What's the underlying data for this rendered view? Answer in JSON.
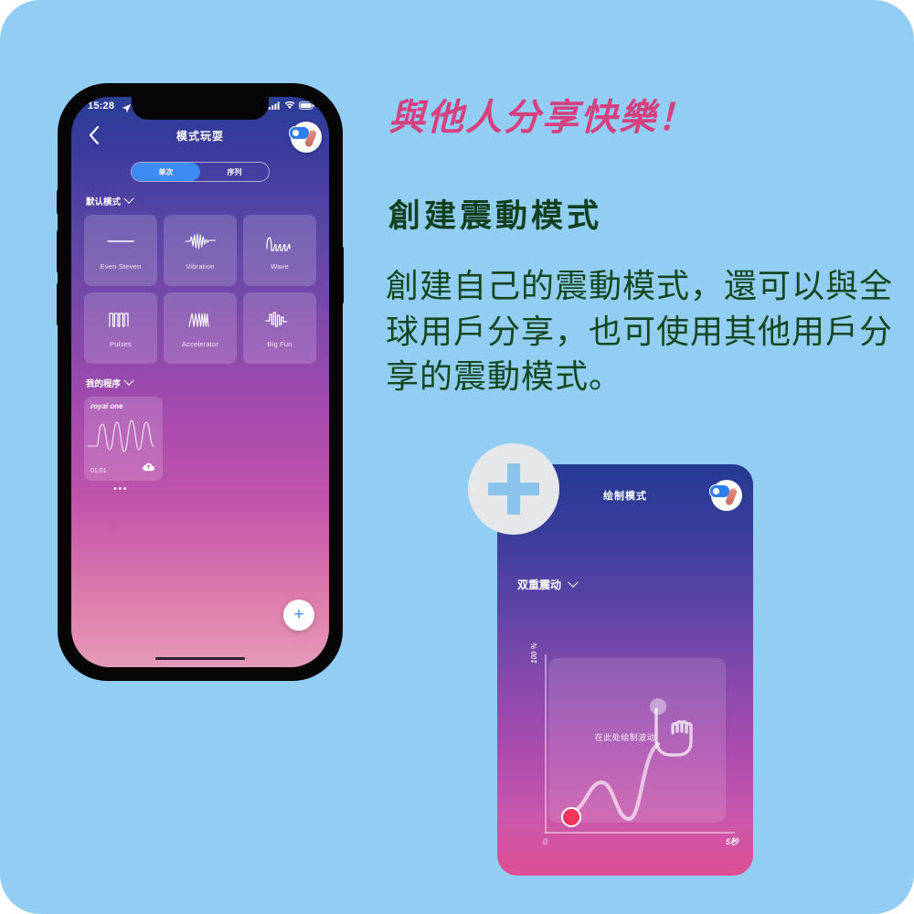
{
  "theme": {
    "background": "#92cdf4",
    "headline_color": "#d6407f",
    "text_color": "#14471f",
    "accent_blue": "#3d8bf5",
    "dot_red": "#f8335e"
  },
  "promo": {
    "headline": "與他人分享快樂！",
    "subheading": "創建震動模式",
    "body": "創建自己的震動模式，還可以與全球用戶分享，也可使用其他用戶分享的震動模式。"
  },
  "phone": {
    "statusbar": {
      "time": "15:28",
      "location_icon": "location-arrow-icon",
      "cellular_icon": "cellular-bars-icon",
      "wifi_icon": "wifi-icon",
      "battery_icon": "battery-icon"
    },
    "header": {
      "back_icon": "chevron-left-icon",
      "title": "模式玩耍",
      "logo": "app-logo-icon"
    },
    "segmented": {
      "options": [
        "单次",
        "序列"
      ],
      "selected": "单次"
    },
    "sections": [
      {
        "label": "默认模式",
        "chevron": "chevron-down-icon"
      },
      {
        "label": "我的程序",
        "chevron": "chevron-down-icon"
      }
    ],
    "patterns": [
      {
        "label": "Even Steven",
        "icon": "flat-line-waveform-icon"
      },
      {
        "label": "Vibration",
        "icon": "dense-spike-waveform-icon"
      },
      {
        "label": "Wave",
        "icon": "sine-waveform-icon"
      },
      {
        "label": "Pulses",
        "icon": "square-pulse-waveform-icon"
      },
      {
        "label": "Accelerator",
        "icon": "ramp-spike-waveform-icon"
      },
      {
        "label": "Big Fun",
        "icon": "step-burst-waveform-icon"
      }
    ],
    "program": {
      "name": "royal one",
      "duration": "01:01",
      "cloud_icon": "cloud-upload-icon",
      "more_icon": "more-dots-icon"
    },
    "fab": {
      "label": "+",
      "icon": "plus-icon"
    }
  },
  "draw_card": {
    "title": "绘制模式",
    "logo": "app-logo-icon",
    "mode_label": "双重震动",
    "mode_chevron": "chevron-down-icon",
    "hint": "在此处绘制波动",
    "y_axis_label": "100 %",
    "x_axis_start": "0",
    "x_axis_end": "5秒",
    "cursor_icon": "hand-pointer-icon",
    "start_dot": "start-point-marker"
  },
  "plus_button": {
    "icon": "plus-icon"
  }
}
